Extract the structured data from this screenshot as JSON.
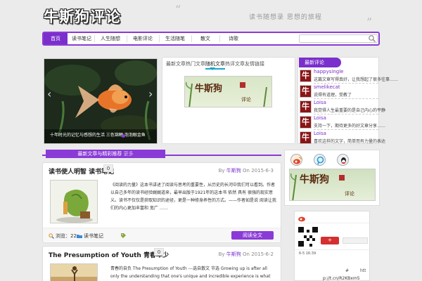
{
  "site": {
    "title": "牛斯狗评论",
    "tagline": "读书随想录 思想的旅程",
    "quote_open": "“",
    "quote_close": "”"
  },
  "nav": {
    "items": [
      "首页",
      "读书笔记",
      "人生随想",
      "电影评论",
      "生活随笔",
      "散文",
      "诗歌"
    ],
    "active_index": 0,
    "search_placeholder": ""
  },
  "slider": {
    "caption": "十年时光的记忆与感想的生活 三色锦鲤 泡泡眼金鱼",
    "prev": "‹",
    "next": "›"
  },
  "tabs": {
    "items": [
      "最新文章",
      "热门文章",
      "随机文章",
      "热评文章",
      "友情链接"
    ],
    "active_index": 2,
    "banner_text": "牛斯狗",
    "banner_sub": "评论"
  },
  "comments": {
    "header": "最新评论",
    "avatar_char": "牛",
    "items": [
      {
        "name": "happysingle",
        "text": "这篇文章写得真好，让我想起了很多往事……"
      },
      {
        "name": "smelikecat",
        "text": "说得有道理，受教了"
      },
      {
        "name": "Loisa",
        "text": "我觉得人生最重要的是自己内心的平静"
      },
      {
        "name": "Loisa",
        "text": "支持一下，期待更多的好文章分享……"
      },
      {
        "name": "Loisa",
        "text": "喜欢这样的文字，简单而有力量的表达"
      }
    ]
  },
  "section": {
    "title": "最新文章与精彩推荐",
    "sub": "更多"
  },
  "posts": [
    {
      "title": "读书使人明智 读书笔记",
      "comments": "0",
      "author_label": "By",
      "author": "牛斯狗",
      "date_label": "On",
      "date": "2015-6-3",
      "excerpt": "《阅读的力量》这本书讲述了阅读与思考的重要性，从历史的长河中我们可以看到。作者以自己多年的读书经验娓娓道来，最早出版于1921年的这本书 依然 具有 很强的现实意义。读书不仅仅是获取知识的途径，更是一种修身养性的方式。——作者如是说 阅读让我们的内心更加丰富和 宽广 ……",
      "views": "浏览：22",
      "category": "读书笔记",
      "tag": "",
      "read_more": "阅读全文"
    },
    {
      "title": "The Presumption of Youth 青春年少",
      "comments": "0",
      "author_label": "By",
      "author": "牛斯狗",
      "date_label": "On",
      "date": "2015-6-2",
      "excerpt": "青春的自负 The Presumption of Youth ---选自散文 节选 Growing up is after all only the understanding that one's unique and incredible experience is what"
    }
  ],
  "sidebar": {
    "weibo_follow": "+",
    "weibo_time": "6-5 16:39",
    "weibo_hash": "#",
    "weibo_ht": "htt",
    "weibo_link": "p://t.cn/R2KBxm5"
  },
  "colors": {
    "accent": "#8a3ad6",
    "accent_dark": "#7a2fcc",
    "tab_underline": "#19a7c9",
    "avatar_bg": "#8b1515"
  }
}
